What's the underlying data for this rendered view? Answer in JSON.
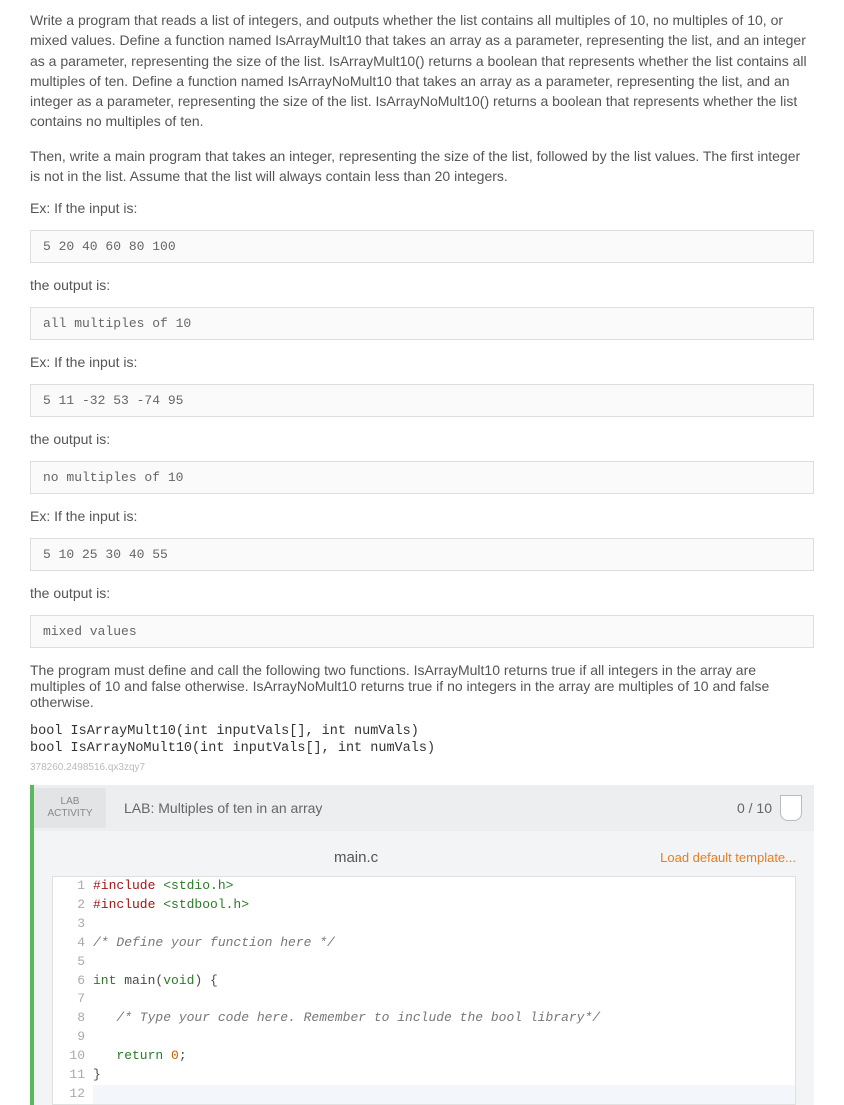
{
  "intro": {
    "p1": "Write a program that reads a list of integers, and outputs whether the list contains all multiples of 10, no multiples of 10, or mixed values. Define a function named IsArrayMult10 that takes an array as a parameter, representing the list, and an integer as a parameter, representing the size of the list. IsArrayMult10() returns a boolean that represents whether the list contains all multiples of ten. Define a function named IsArrayNoMult10 that takes an array as a parameter, representing the list, and an integer as a parameter, representing the size of the list. IsArrayNoMult10() returns a boolean that represents whether the list contains no multiples of ten.",
    "p2": "Then, write a main program that takes an integer, representing the size of the list, followed by the list values. The first integer is not in the list. Assume that the list will always contain less than 20 integers."
  },
  "ex1": {
    "label": "Ex: If the input is:",
    "input": "5 20 40 60 80 100",
    "outlabel": "the output is:",
    "output": "all multiples of 10"
  },
  "ex2": {
    "label": "Ex: If the input is:",
    "input": "5 11 -32 53 -74 95",
    "outlabel": "the output is:",
    "output": "no multiples of 10"
  },
  "ex3": {
    "label": "Ex: If the input is:",
    "input": "5 10 25 30 40 55",
    "outlabel": "the output is:",
    "output": "mixed values"
  },
  "musttext": "The program must define and call the following two functions. IsArrayMult10 returns true if all integers in the array are multiples of 10 and false otherwise. IsArrayNoMult10 returns true if no integers in the array are multiples of 10 and false otherwise.",
  "sig1": "bool IsArrayMult10(int inputVals[], int numVals)",
  "sig2": "bool IsArrayNoMult10(int inputVals[], int numVals)",
  "tinyid": "378260.2498516.qx3zqy7",
  "lab": {
    "activity_label_1": "LAB",
    "activity_label_2": "ACTIVITY",
    "title": "LAB: Multiples of ten in an array",
    "score": "0 / 10",
    "filename": "main.c",
    "load_template": "Load default template..."
  },
  "code": {
    "l1_pp": "#include ",
    "l1_h": "<stdio.h>",
    "l2_pp": "#include ",
    "l2_h": "<stdbool.h>",
    "l3": "",
    "l4": "/* Define your function here */",
    "l5": "",
    "l6_kw": "int",
    "l6_rest": " main(",
    "l6_void": "void",
    "l6_end": ") {",
    "l7": "",
    "l8": "   /* Type your code here. Remember to include the bool library*/",
    "l9": "",
    "l10_a": "   ",
    "l10_kw": "return",
    "l10_sp": " ",
    "l10_num": "0",
    "l10_end": ";",
    "l11": "}",
    "l12": ""
  },
  "linenums": [
    "1",
    "2",
    "3",
    "4",
    "5",
    "6",
    "7",
    "8",
    "9",
    "10",
    "11",
    "12"
  ]
}
